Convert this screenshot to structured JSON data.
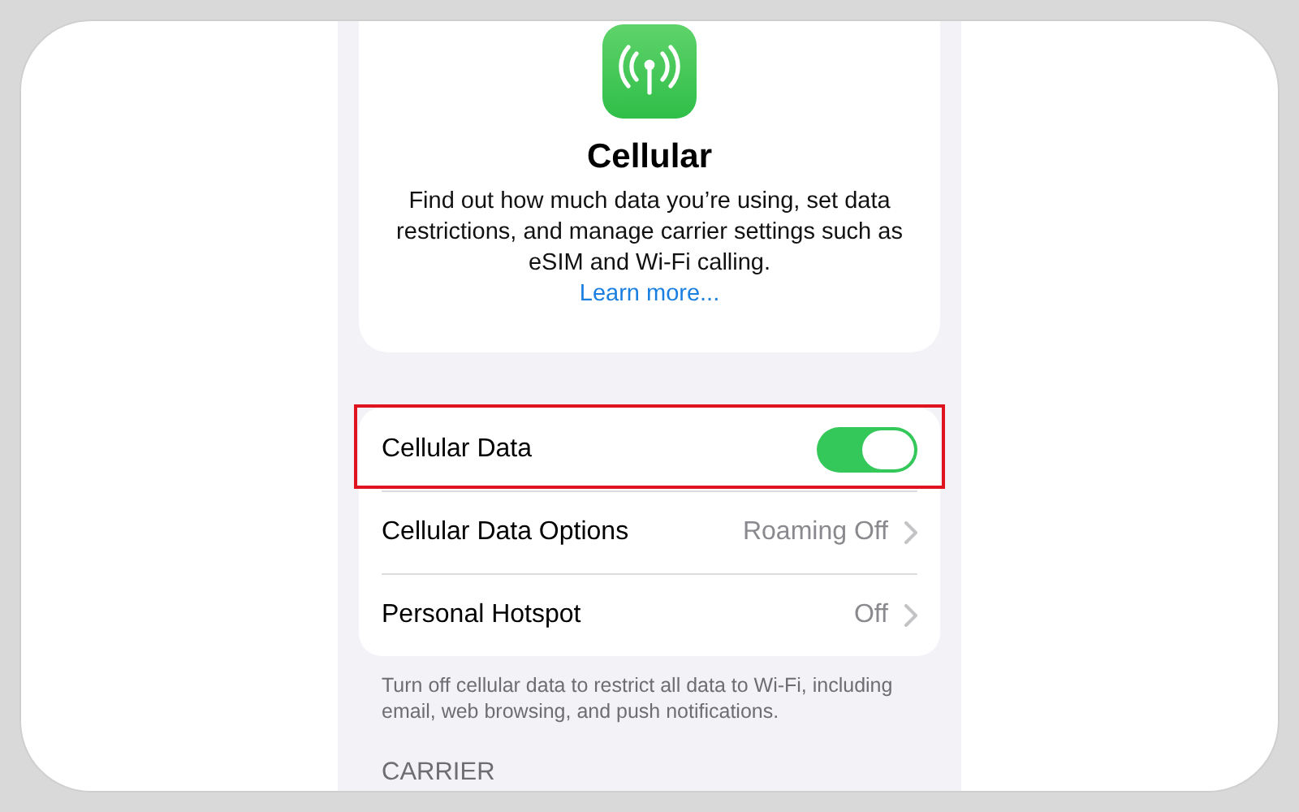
{
  "header": {
    "title": "Cellular",
    "description": "Find out how much data you’re using, set data restrictions, and manage carrier settings such as eSIM and Wi-Fi calling.",
    "link": "Learn more..."
  },
  "rows": [
    {
      "label": "Cellular Data",
      "kind": "toggle",
      "on": true,
      "highlighted": true
    },
    {
      "label": "Cellular Data Options",
      "kind": "link",
      "value": "Roaming Off",
      "highlighted": false
    },
    {
      "label": "Personal Hotspot",
      "kind": "link",
      "value": "Off",
      "highlighted": false
    }
  ],
  "footer": "Turn off cellular data to restrict all data to Wi-Fi, including email, web browsing, and push notifications.",
  "section_header": "CARRIER"
}
